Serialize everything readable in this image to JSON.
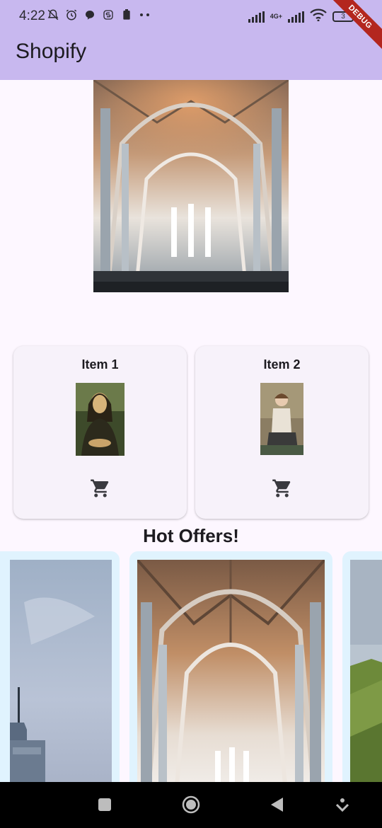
{
  "status_bar": {
    "time": "4:22",
    "network": "4G+",
    "battery": "3",
    "debug_label": "DEBUG"
  },
  "app_bar": {
    "title": "Shopify"
  },
  "hero": {
    "image": "cathedral-interior"
  },
  "products": [
    {
      "name": "Item 1",
      "image": "mona-lisa-painting",
      "cart_icon": "cart-icon"
    },
    {
      "name": "Item 2",
      "image": "girl-portrait-painting",
      "cart_icon": "cart-icon"
    }
  ],
  "offers": {
    "title": "Hot Offers!",
    "items": [
      {
        "image": "skyscraper-sky"
      },
      {
        "image": "cathedral-interior"
      },
      {
        "image": "green-hills"
      }
    ]
  },
  "colors": {
    "app_bar": "#c8b8ef",
    "background": "#fdf7ff",
    "card": "#f7f2fa",
    "offer_frame": "#e0f3fe",
    "debug_banner": "#b3261e"
  }
}
